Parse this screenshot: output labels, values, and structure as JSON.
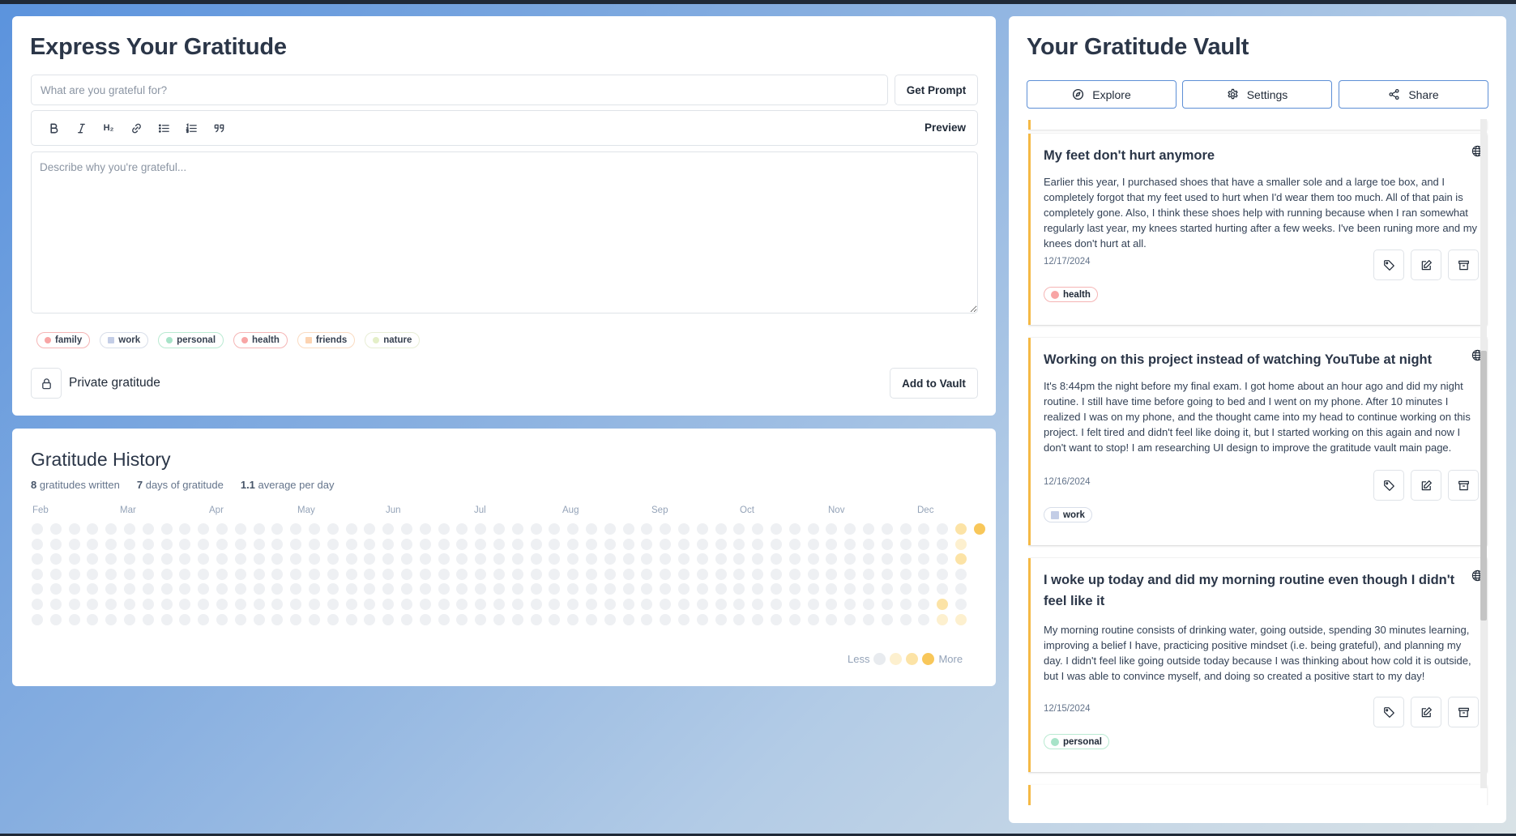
{
  "composer": {
    "title": "Express Your Gratitude",
    "title_placeholder": "What are you grateful for?",
    "get_prompt_label": "Get Prompt",
    "toolbar": {
      "bold_icon": "bold-icon",
      "italic_icon": "italic-icon",
      "heading_label": "H₂",
      "link_icon": "link-icon",
      "bullet_list_icon": "bullet-list-icon",
      "numbered_list_icon": "numbered-list-icon",
      "quote_icon": "quote-icon",
      "preview_label": "Preview"
    },
    "body_placeholder": "Describe why you're grateful...",
    "tags": [
      {
        "label": "family",
        "color": "#f8a5a5",
        "border": "#f5b5b5",
        "shape": "dot"
      },
      {
        "label": "work",
        "color": "#c3cde6",
        "border": "#d8dee9",
        "shape": "square"
      },
      {
        "label": "personal",
        "color": "#a7e3c8",
        "border": "#b9ead2",
        "shape": "dot"
      },
      {
        "label": "health",
        "color": "#f8a5a5",
        "border": "#f5b5b5",
        "shape": "dot"
      },
      {
        "label": "friends",
        "color": "#fcd3b1",
        "border": "#fadbc1",
        "shape": "square"
      },
      {
        "label": "nature",
        "color": "#e4efc8",
        "border": "#e8eed6",
        "shape": "dot"
      }
    ],
    "private_label": "Private gratitude",
    "add_label": "Add to Vault"
  },
  "history": {
    "title": "Gratitude History",
    "stats": [
      {
        "value": "8",
        "label": "gratitudes written"
      },
      {
        "value": "7",
        "label": "days of gratitude"
      },
      {
        "value": "1.1",
        "label": "average per day"
      }
    ],
    "months": [
      "Feb",
      "Mar",
      "Apr",
      "May",
      "Jun",
      "Jul",
      "Aug",
      "Sep",
      "Oct",
      "Nov",
      "Dec"
    ],
    "legend_less": "Less",
    "legend_more": "More",
    "colors": {
      "empty": "#eef0f3",
      "l1": "#fdf0cf",
      "l2": "#fce3a6",
      "l3": "#f8c75a"
    }
  },
  "vault": {
    "title": "Your Gratitude Vault",
    "buttons": [
      {
        "label": "Explore",
        "icon": "compass-icon"
      },
      {
        "label": "Settings",
        "icon": "gear-icon"
      },
      {
        "label": "Share",
        "icon": "share-icon"
      }
    ],
    "entries": [
      {
        "title": "My feet don't hurt anymore",
        "body": "Earlier this year, I purchased shoes that have a smaller sole and a large toe box, and I completely forgot that my feet used to hurt when I'd wear them too much. All of that pain is completely gone. Also, I think these shoes help with running because when I ran somewhat regularly last year, my knees started hurting after a few weeks. I've been runing more and my knees don't hurt at all.",
        "date": "12/17/2024",
        "tag": "health"
      },
      {
        "title": "Working on this project instead of watching YouTube at night",
        "body": "It's 8:44pm the night before my final exam. I got home about an hour ago and did my night routine. I still have time before going to bed and I went on my phone. After 10 minutes I realized I was on my phone, and the thought came into my head to continue working on this project. I felt tired and didn't feel like doing it, but I started working on this again and now I don't want to stop! I am researching UI design to improve the gratitude vault main page.",
        "date": "12/16/2024",
        "tag": "work"
      },
      {
        "title": "I woke up today and did my morning routine even though I didn't feel like it",
        "body": "My morning routine consists of drinking water, going outside, spending 30 minutes learning, improving a belief I have, practicing positive mindset (i.e. being grateful), and planning my day. I didn't feel like going outside today because I was thinking about how cold it is outside, but I was able to convince myself, and doing so created a positive start to my day!",
        "date": "12/15/2024",
        "tag": "personal"
      }
    ]
  }
}
